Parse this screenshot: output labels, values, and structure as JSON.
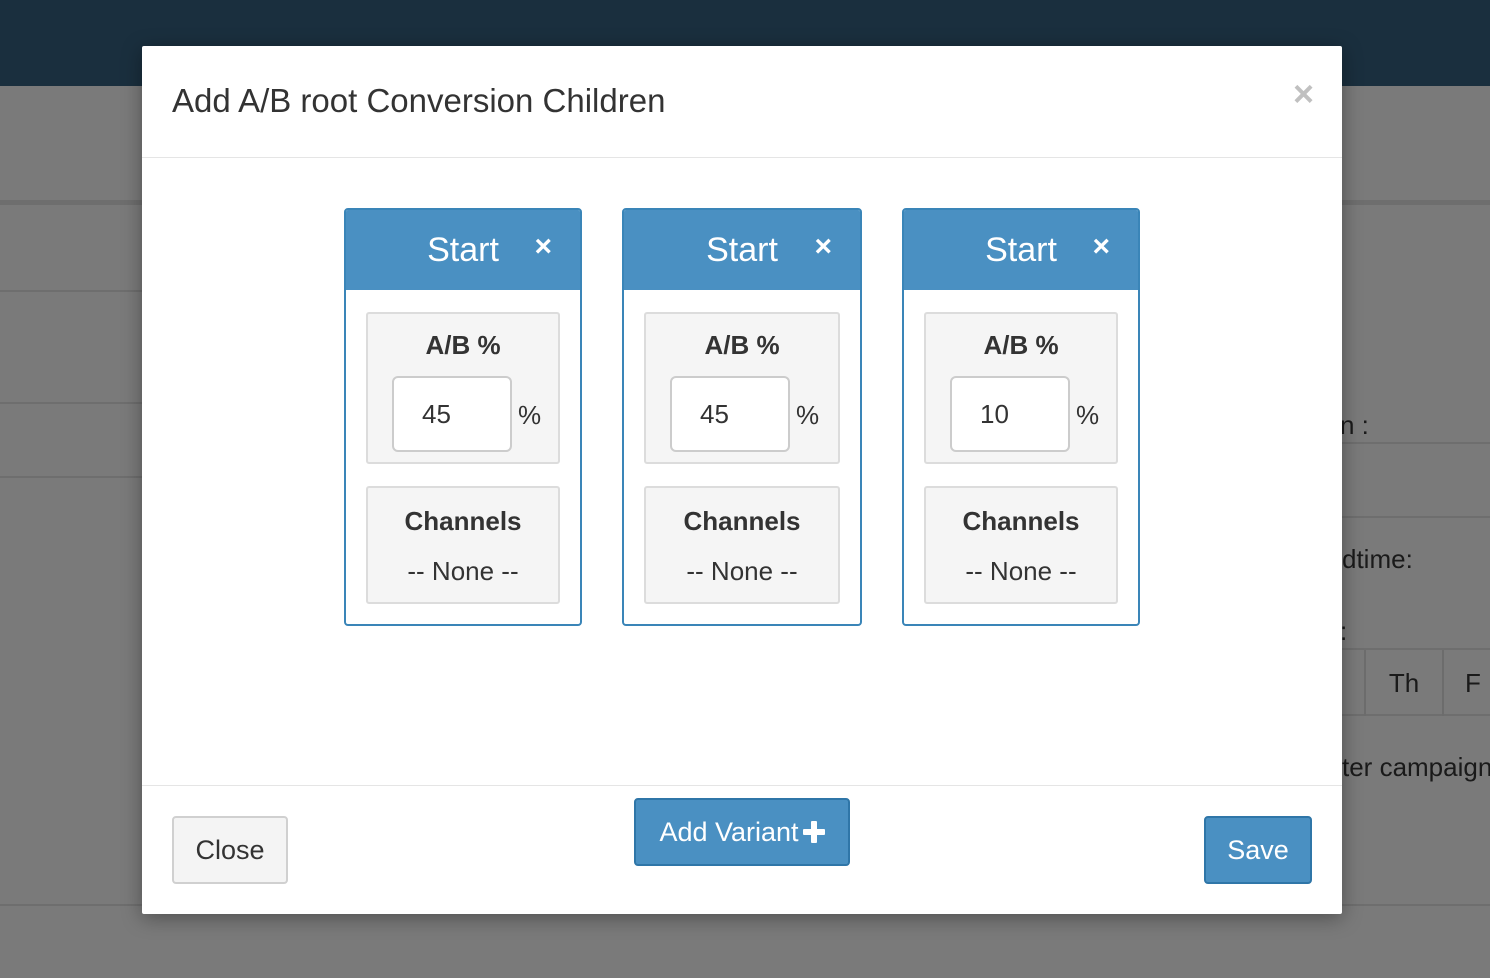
{
  "background": {
    "partial_labels": [
      "n :",
      "dtime:",
      ":",
      "ter campaign"
    ],
    "day_columns": [
      "Th",
      "F"
    ]
  },
  "modal": {
    "title": "Add A/B root Conversion Children",
    "close_symbol": "×",
    "variants": [
      {
        "title": "Start",
        "remove_symbol": "×",
        "ab_label": "A/B %",
        "ab_value": "45",
        "pct_symbol": "%",
        "channels_label": "Channels",
        "channels_value": "-- None --"
      },
      {
        "title": "Start",
        "remove_symbol": "×",
        "ab_label": "A/B %",
        "ab_value": "45",
        "pct_symbol": "%",
        "channels_label": "Channels",
        "channels_value": "-- None --"
      },
      {
        "title": "Start",
        "remove_symbol": "×",
        "ab_label": "A/B %",
        "ab_value": "10",
        "pct_symbol": "%",
        "channels_label": "Channels",
        "channels_value": "-- None --"
      }
    ],
    "add_variant_label": "Add Variant",
    "footer": {
      "close_label": "Close",
      "save_label": "Save"
    }
  },
  "colors": {
    "primary": "#4a90c2",
    "topbar": "#1a2f3e"
  }
}
